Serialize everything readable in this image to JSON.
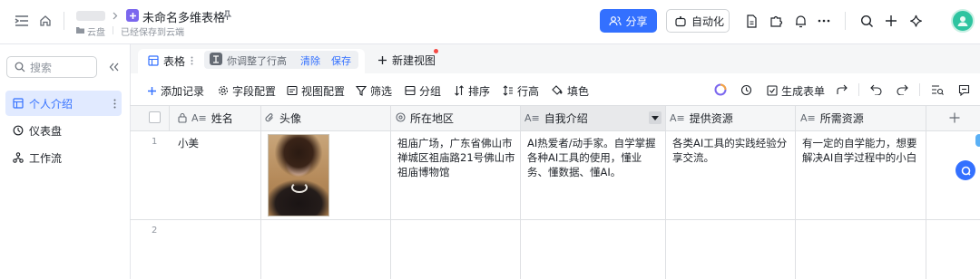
{
  "header": {
    "workspace_blurred": "",
    "doc_title": "未命名多维表格",
    "breadcrumb_location": "云盘",
    "save_status": "已经保存到云端",
    "share_label": "分享",
    "automation_label": "自动化",
    "avatar_color": "#2ec4a0"
  },
  "sidebar": {
    "search_placeholder": "搜索",
    "items": [
      {
        "label": "个人介绍",
        "icon": "table-icon",
        "active": true
      },
      {
        "label": "仪表盘",
        "icon": "dashboard-icon"
      },
      {
        "label": "工作流",
        "icon": "workflow-icon"
      }
    ]
  },
  "view_bar": {
    "view_label": "表格",
    "notice": "你调整了行高",
    "clear_label": "清除",
    "save_label": "保存",
    "new_view_label": "新建视图"
  },
  "toolbar": {
    "add_record": "添加记录",
    "field_config": "字段配置",
    "view_config": "视图配置",
    "filter": "筛选",
    "group": "分组",
    "sort": "排序",
    "row_height": "行高",
    "fill_color": "填色",
    "generate_form": "生成表单"
  },
  "table": {
    "columns": [
      {
        "label": "姓名",
        "icon": "text-field-icon",
        "locked": true
      },
      {
        "label": "头像",
        "icon": "attachment-icon"
      },
      {
        "label": "所在地区",
        "icon": "location-icon"
      },
      {
        "label": "自我介绍",
        "icon": "text-field-icon",
        "selected": true
      },
      {
        "label": "提供资源",
        "icon": "text-field-icon"
      },
      {
        "label": "所需资源",
        "icon": "text-field-icon"
      }
    ],
    "rows": [
      {
        "num": "1",
        "name": "小美",
        "location": "祖庙广场，广东省佛山市禅城区祖庙路21号佛山市祖庙博物馆",
        "intro": "AI热爱者/动手家。自学掌握各种AI工具的使用，懂业务、懂数据、懂AI。",
        "offer": "各类AI工具的实践经验分享交流。",
        "need": "有一定的自学能力，想要解决AI自学过程中的小白"
      },
      {
        "num": "2"
      }
    ]
  },
  "colors": {
    "accent": "#3370ff",
    "selected_header": "#e8e9eb",
    "sidebar_active": "#e1eaff"
  }
}
